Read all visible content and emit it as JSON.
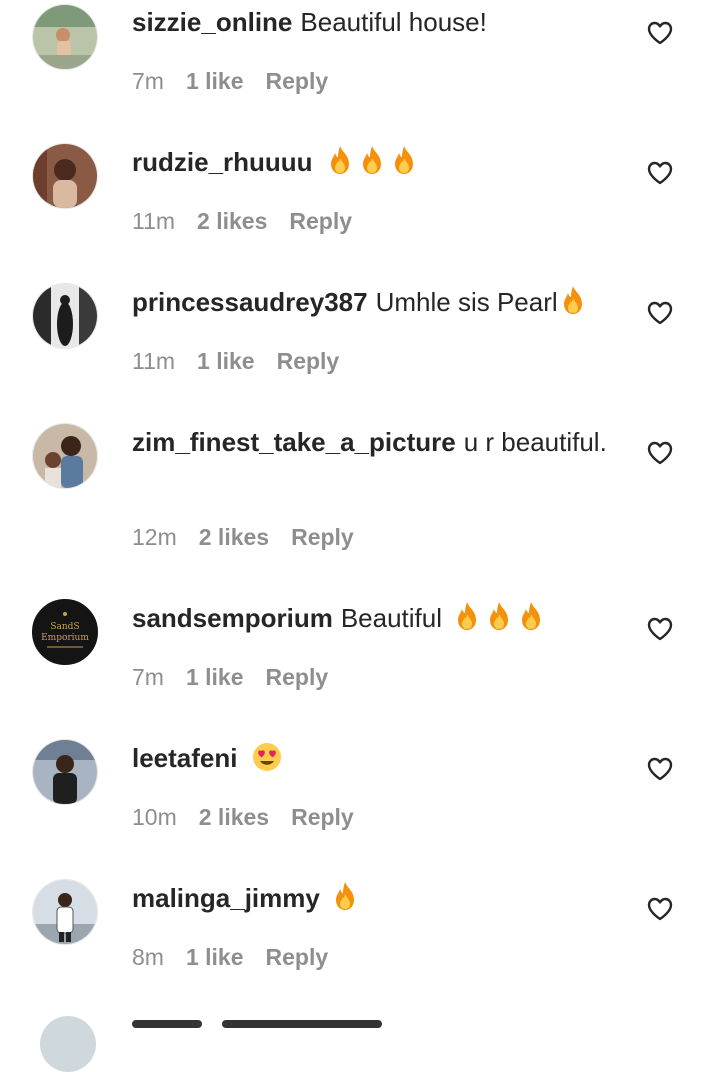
{
  "comments": [
    {
      "username": "sizzie_online",
      "text": "Beautiful house!",
      "time": "7m",
      "likes": "1 like",
      "reply": "Reply"
    },
    {
      "username": "rudzie_rhuuuu",
      "text": "",
      "time": "11m",
      "likes": "2 likes",
      "reply": "Reply"
    },
    {
      "username": "princessaudrey387",
      "text": "Umhle sis Pearl",
      "time": "11m",
      "likes": "1 like",
      "reply": "Reply"
    },
    {
      "username": "zim_finest_take_a_picture",
      "text": "u r beautiful.",
      "time": "12m",
      "likes": "2 likes",
      "reply": "Reply"
    },
    {
      "username": "sandsemporium",
      "text": "Beautiful",
      "time": "7m",
      "likes": "1 like",
      "reply": "Reply"
    },
    {
      "username": "leetafeni",
      "text": "",
      "time": "10m",
      "likes": "2 likes",
      "reply": "Reply"
    },
    {
      "username": "malinga_jimmy",
      "text": "",
      "time": "8m",
      "likes": "1 like",
      "reply": "Reply"
    }
  ],
  "avatar_logo": {
    "line1": "SandS",
    "line2": "Emporium"
  },
  "icons": {
    "like": "heart-outline-icon",
    "fire": "fire-emoji-icon",
    "heart_eyes": "heart-eyes-emoji-icon"
  },
  "colors": {
    "text": "#262626",
    "meta": "#8e8e8e",
    "background": "#ffffff"
  }
}
